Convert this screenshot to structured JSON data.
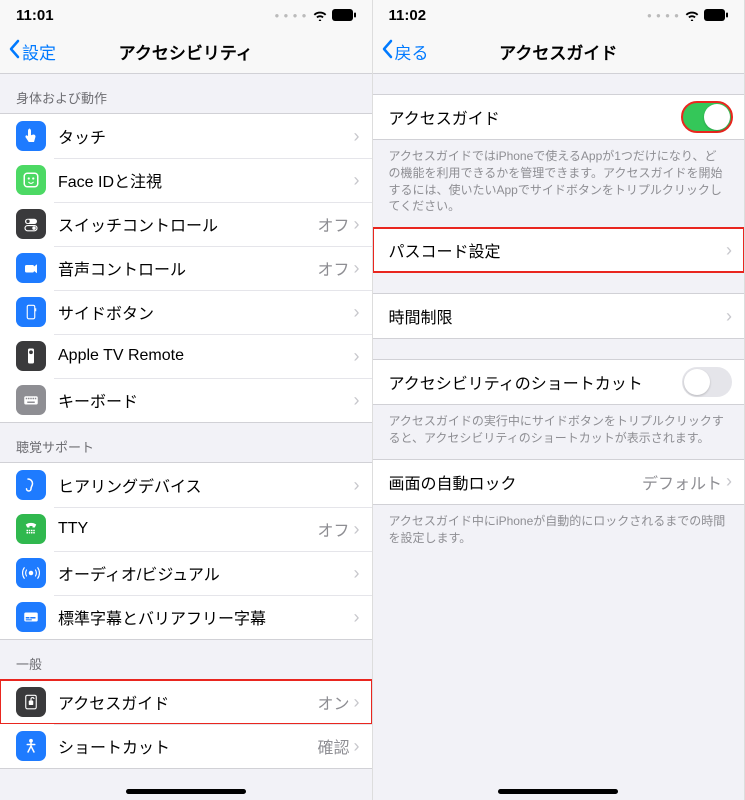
{
  "left": {
    "status_time": "11:01",
    "back_label": "設定",
    "title": "アクセシビリティ",
    "section_physical": "身体および動作",
    "section_hearing": "聴覚サポート",
    "section_general": "一般",
    "items_physical": [
      {
        "label": "タッチ",
        "value": "",
        "icon_bg": "#1e7bff"
      },
      {
        "label": "Face IDと注視",
        "value": "",
        "icon_bg": "#4cd964"
      },
      {
        "label": "スイッチコントロール",
        "value": "オフ",
        "icon_bg": "#3a3a3c"
      },
      {
        "label": "音声コントロール",
        "value": "オフ",
        "icon_bg": "#1e7bff"
      },
      {
        "label": "サイドボタン",
        "value": "",
        "icon_bg": "#1e7bff"
      },
      {
        "label": "Apple TV Remote",
        "value": "",
        "icon_bg": "#3a3a3c"
      },
      {
        "label": "キーボード",
        "value": "",
        "icon_bg": "#8e8e93"
      }
    ],
    "items_hearing": [
      {
        "label": "ヒアリングデバイス",
        "value": "",
        "icon_bg": "#1e7bff"
      },
      {
        "label": "TTY",
        "value": "オフ",
        "icon_bg": "#30b84e"
      },
      {
        "label": "オーディオ/ビジュアル",
        "value": "",
        "icon_bg": "#1e7bff"
      },
      {
        "label": "標準字幕とバリアフリー字幕",
        "value": "",
        "icon_bg": "#1e7bff"
      }
    ],
    "items_general": [
      {
        "label": "アクセスガイド",
        "value": "オン",
        "icon_bg": "#3a3a3c",
        "highlight": true
      },
      {
        "label": "ショートカット",
        "value": "確認",
        "icon_bg": "#1e7bff"
      }
    ]
  },
  "right": {
    "status_time": "11:02",
    "back_label": "戻る",
    "title": "アクセスガイド",
    "toggle_label": "アクセスガイド",
    "toggle_on": true,
    "toggle_footer": "アクセスガイドではiPhoneで使えるAppが1つだけになり、どの機能を利用できるかを管理できます。アクセスガイドを開始するには、使いたいAppでサイドボタンをトリプルクリックしてください。",
    "passcode_label": "パスコード設定",
    "time_limit_label": "時間制限",
    "shortcut_label": "アクセシビリティのショートカット",
    "shortcut_footer": "アクセスガイドの実行中にサイドボタンをトリプルクリックすると、アクセシビリティのショートカットが表示されます。",
    "autolock_label": "画面の自動ロック",
    "autolock_value": "デフォルト",
    "autolock_footer": "アクセスガイド中にiPhoneが自動的にロックされるまでの時間を設定します。"
  }
}
